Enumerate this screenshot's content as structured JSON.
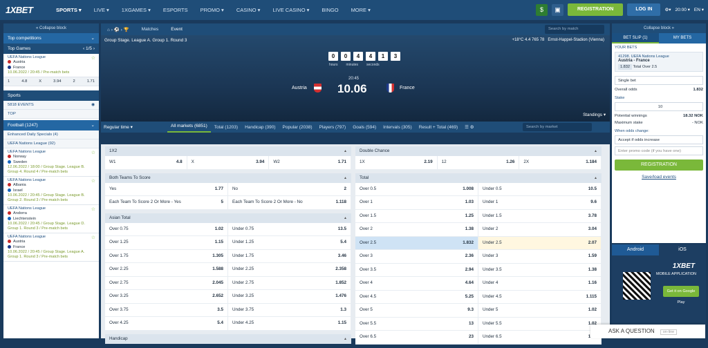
{
  "topbar": {
    "logo": "1XBET",
    "nav": [
      "SPORTS ▾",
      "LIVE ▾",
      "1XGAMES ▾",
      "ESPORTS",
      "PROMO ▾",
      "CASINO ▾",
      "LIVE CASINO ▾",
      "BINGO",
      "MORE ▾"
    ],
    "registration": "REGISTRATION",
    "login": "LOG IN",
    "time": "20:00 ▾",
    "lang": "EN ▾"
  },
  "left": {
    "collapse": "« Collapse block",
    "top_competitions": "Top competitions",
    "top_games": "Top Games",
    "pager": "‹ 1/5 ›",
    "match0": {
      "league": "UEFA Nations League",
      "team1": "Austria",
      "team2": "France",
      "info": "10.06.2022 / 20:45 / Pre-match bets",
      "odds": [
        "1",
        "4.8",
        "X",
        "3.94",
        "2",
        "1.71"
      ]
    },
    "sports": "Sports",
    "events": "5818 EVENTS",
    "top": "TOP",
    "football": "Football (1247)",
    "enhanced": "Enhanced Daily Specials (4)",
    "uefa": "UEFA Nations League (92)",
    "matches": [
      {
        "league": "UEFA Nations League",
        "team1": "Norway",
        "team2": "Sweden",
        "info": "12.06.2022 / 18:00 / Group Stage. League B. Group 4. Round 4 / Pre-match bets"
      },
      {
        "league": "UEFA Nations League",
        "team1": "Albania",
        "team2": "Israel",
        "info": "10.06.2022 / 20:45 / Group Stage. League B. Group 2. Round 3 / Pre-match bets"
      },
      {
        "league": "UEFA Nations League",
        "team1": "Andorra",
        "team2": "Liechtenstein",
        "info": "10.06.2022 / 20:45 / Group Stage. League D. Group 1. Round 3 / Pre-match bets"
      },
      {
        "league": "UEFA Nations League",
        "team1": "Austria",
        "team2": "France",
        "info": "10.06.2022 / 20:45 / Group Stage. League A. Group 1. Round 3 / Pre-match bets"
      }
    ]
  },
  "event": {
    "tabs": [
      "Matches",
      "Event"
    ],
    "search": "Search by match",
    "stage": "Group Stage. League A. Group 1. Round 3",
    "weather": "+18°C   4.4   765   78",
    "stadium": "Ernst-Happel-Stadion (Vienna)",
    "timer": [
      "0",
      "0",
      "4",
      "4",
      "1",
      "3"
    ],
    "timer_labels": [
      "hours",
      "minutes",
      "seconds"
    ],
    "kickoff": "20:45",
    "date": "10.06",
    "team1": "Austria",
    "team2": "France",
    "standings": "Standings ▾"
  },
  "marketbar": {
    "regular": "Regular time ▾",
    "tabs": [
      "All markets (6851)",
      "Total (1203)",
      "Handicap (390)",
      "Popular (2038)",
      "Players (797)",
      "Goals (594)",
      "Intervals (305)",
      "Result + Total (469)"
    ],
    "search": "Search by market"
  },
  "markets": {
    "x12": {
      "title": "1X2",
      "cells": [
        [
          "W1",
          "4.8"
        ],
        [
          "X",
          "3.94"
        ],
        [
          "W2",
          "1.71"
        ]
      ]
    },
    "double": {
      "title": "Double Chance",
      "cells": [
        [
          "1X",
          "2.19"
        ],
        [
          "12",
          "1.26"
        ],
        [
          "2X",
          "1.184"
        ]
      ]
    },
    "btts": {
      "title": "Both Teams To Score",
      "rows": [
        [
          [
            "Yes",
            "1.77"
          ],
          [
            "No",
            "2"
          ]
        ],
        [
          [
            "Each Team To Score 2 Or More - Yes",
            "5"
          ],
          [
            "Each Team To Score 2 Or More - No",
            "1.118"
          ]
        ]
      ]
    },
    "asian": {
      "title": "Asian Total",
      "rows": [
        [
          [
            "Over 0.75",
            "1.02"
          ],
          [
            "Under 0.75",
            "13.5"
          ]
        ],
        [
          [
            "Over 1.25",
            "1.15"
          ],
          [
            "Under 1.25",
            "5.4"
          ]
        ],
        [
          [
            "Over 1.75",
            "1.305"
          ],
          [
            "Under 1.75",
            "3.46"
          ]
        ],
        [
          [
            "Over 2.25",
            "1.588"
          ],
          [
            "Under 2.25",
            "2.358"
          ]
        ],
        [
          [
            "Over 2.75",
            "2.045"
          ],
          [
            "Under 2.75",
            "1.852"
          ]
        ],
        [
          [
            "Over 3.25",
            "2.652"
          ],
          [
            "Under 3.25",
            "1.476"
          ]
        ],
        [
          [
            "Over 3.75",
            "3.5"
          ],
          [
            "Under 3.75",
            "1.3"
          ]
        ],
        [
          [
            "Over 4.25",
            "5.4"
          ],
          [
            "Under 4.25",
            "1.15"
          ]
        ]
      ]
    },
    "handicap": {
      "title": "Handicap"
    },
    "total": {
      "title": "Total",
      "rows": [
        [
          [
            "Over 0.5",
            "1.008"
          ],
          [
            "Under 0.5",
            "10.5"
          ]
        ],
        [
          [
            "Over 1",
            "1.03"
          ],
          [
            "Under 1",
            "9.6"
          ]
        ],
        [
          [
            "Over 1.5",
            "1.25"
          ],
          [
            "Under 1.5",
            "3.78"
          ]
        ],
        [
          [
            "Over 2",
            "1.38"
          ],
          [
            "Under 2",
            "3.04"
          ]
        ],
        [
          [
            "Over 2.5",
            "1.832"
          ],
          [
            "Under 2.5",
            "2.07"
          ]
        ],
        [
          [
            "Over 3",
            "2.36"
          ],
          [
            "Under 3",
            "1.59"
          ]
        ],
        [
          [
            "Over 3.5",
            "2.94"
          ],
          [
            "Under 3.5",
            "1.38"
          ]
        ],
        [
          [
            "Over 4",
            "4.64"
          ],
          [
            "Under 4",
            "1.16"
          ]
        ],
        [
          [
            "Over 4.5",
            "5.25"
          ],
          [
            "Under 4.5",
            "1.115"
          ]
        ],
        [
          [
            "Over 5",
            "9.3"
          ],
          [
            "Under 5",
            "1.02"
          ]
        ],
        [
          [
            "Over 5.5",
            "13"
          ],
          [
            "Under 5.5",
            "1.02"
          ]
        ],
        [
          [
            "Over 6.5",
            "23"
          ],
          [
            "Under 6.5",
            "1.01"
          ]
        ]
      ]
    }
  },
  "right": {
    "collapse": "Collapse block »",
    "betslip": "BET SLIP (1)",
    "mybets": "MY BETS",
    "yourbets": "YOUR BETS",
    "bet_id": "41298. UEFA Nations League",
    "bet_match": "Austria - France",
    "bet_odd": "1.832",
    "bet_type": "Total Over 2.5",
    "single": "Single bet",
    "overall_label": "Overall odds",
    "overall": "1.832",
    "stake_label": "Stake",
    "stake": "10",
    "winnings_label": "Potential winnings",
    "winnings": "18.32 NOK",
    "maxstake_label": "Maximum stake",
    "maxstake": "- NOK",
    "change_label": "When odds change:",
    "change": "Accept if odds increase",
    "promo": "Enter promo code (if you have one)",
    "register": "REGISTRATION",
    "save": "Save/load events",
    "android": "Android",
    "ios": "iOS",
    "app_logo": "1XBET",
    "app_text": "MOBILE APPLICATION",
    "gplay": "Get it on Google Play"
  },
  "ask": {
    "label": "ASK A QUESTION",
    "status": "on-line"
  }
}
